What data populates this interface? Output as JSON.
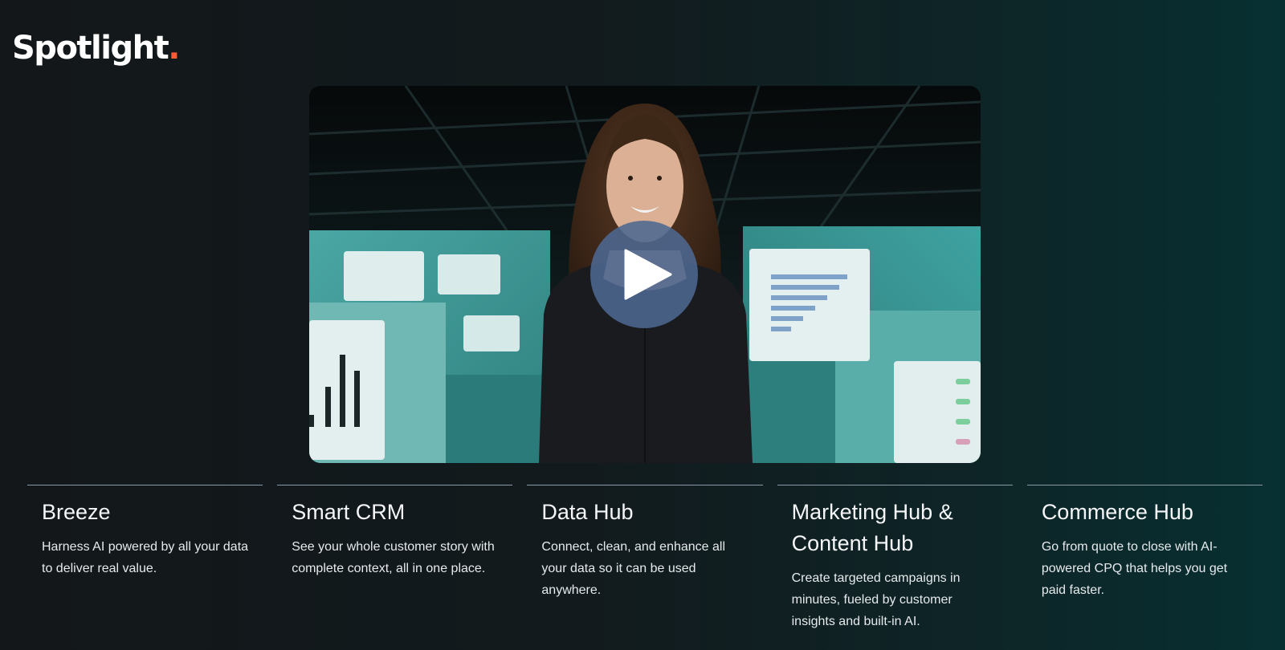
{
  "brand": {
    "name": "Spotlight",
    "dot": ".",
    "accent_color": "#ff5c35"
  },
  "video": {
    "play_icon": "play-icon"
  },
  "cards": [
    {
      "title": "Breeze",
      "description": "Harness AI powered by all your data to deliver real value."
    },
    {
      "title": "Smart CRM",
      "description": "See your whole customer story with complete context, all in one place."
    },
    {
      "title": "Data Hub",
      "description": "Connect, clean, and enhance all your data so it can be used anywhere."
    },
    {
      "title": "Marketing Hub & Content Hub",
      "description": "Create targeted campaigns in minutes, fueled by customer insights and built-in AI."
    },
    {
      "title": "Commerce Hub",
      "description": "Go from quote to close with AI-powered CPQ that helps you get paid faster."
    }
  ]
}
